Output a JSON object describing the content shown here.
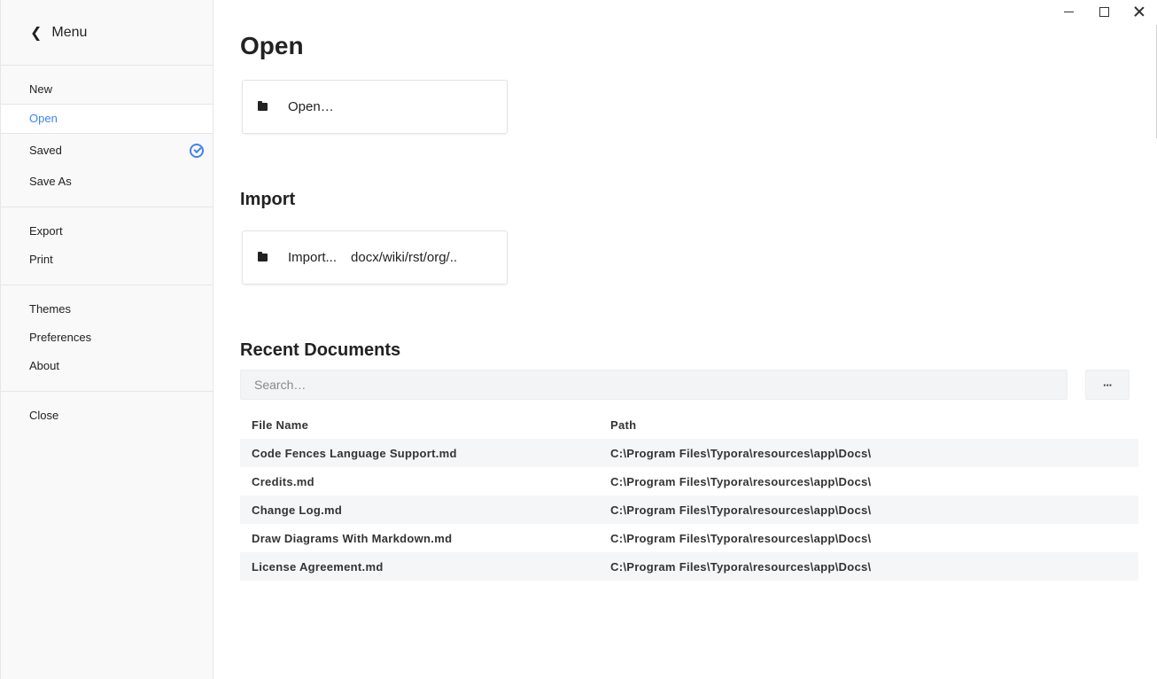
{
  "sidebar": {
    "menu_label": "Menu",
    "items": [
      {
        "label": "New"
      },
      {
        "label": "Open",
        "active": true
      },
      {
        "label": "Saved",
        "checked": true
      },
      {
        "label": "Save As"
      },
      {
        "label": "Export"
      },
      {
        "label": "Print"
      },
      {
        "label": "Themes"
      },
      {
        "label": "Preferences"
      },
      {
        "label": "About"
      },
      {
        "label": "Close"
      }
    ]
  },
  "window_controls": [
    "minimize-icon",
    "maximize-icon",
    "close-icon"
  ],
  "main": {
    "title": "Open",
    "open_card": {
      "label": "Open…",
      "icon": "folder-icon"
    },
    "import_heading": "Import",
    "import_card": {
      "label": "Import...",
      "formats": "docx/wiki/rst/org/..",
      "icon": "folder-icon"
    },
    "recent_heading": "Recent Documents",
    "search": {
      "placeholder": "Search…",
      "value": ""
    },
    "more_label": "···",
    "table": {
      "columns": [
        "File Name",
        "Path"
      ],
      "rows": [
        [
          "Code Fences Language Support.md",
          "C:\\Program Files\\Typora\\resources\\app\\Docs\\"
        ],
        [
          "Credits.md",
          "C:\\Program Files\\Typora\\resources\\app\\Docs\\"
        ],
        [
          "Change Log.md",
          "C:\\Program Files\\Typora\\resources\\app\\Docs\\"
        ],
        [
          "Draw Diagrams With Markdown.md",
          "C:\\Program Files\\Typora\\resources\\app\\Docs\\"
        ],
        [
          "License Agreement.md",
          "C:\\Program Files\\Typora\\resources\\app\\Docs\\"
        ]
      ]
    }
  },
  "colors": {
    "accent": "#4183f1",
    "sidebar_bg": "#f9f9f9",
    "row_alt": "#f5f6f7"
  }
}
